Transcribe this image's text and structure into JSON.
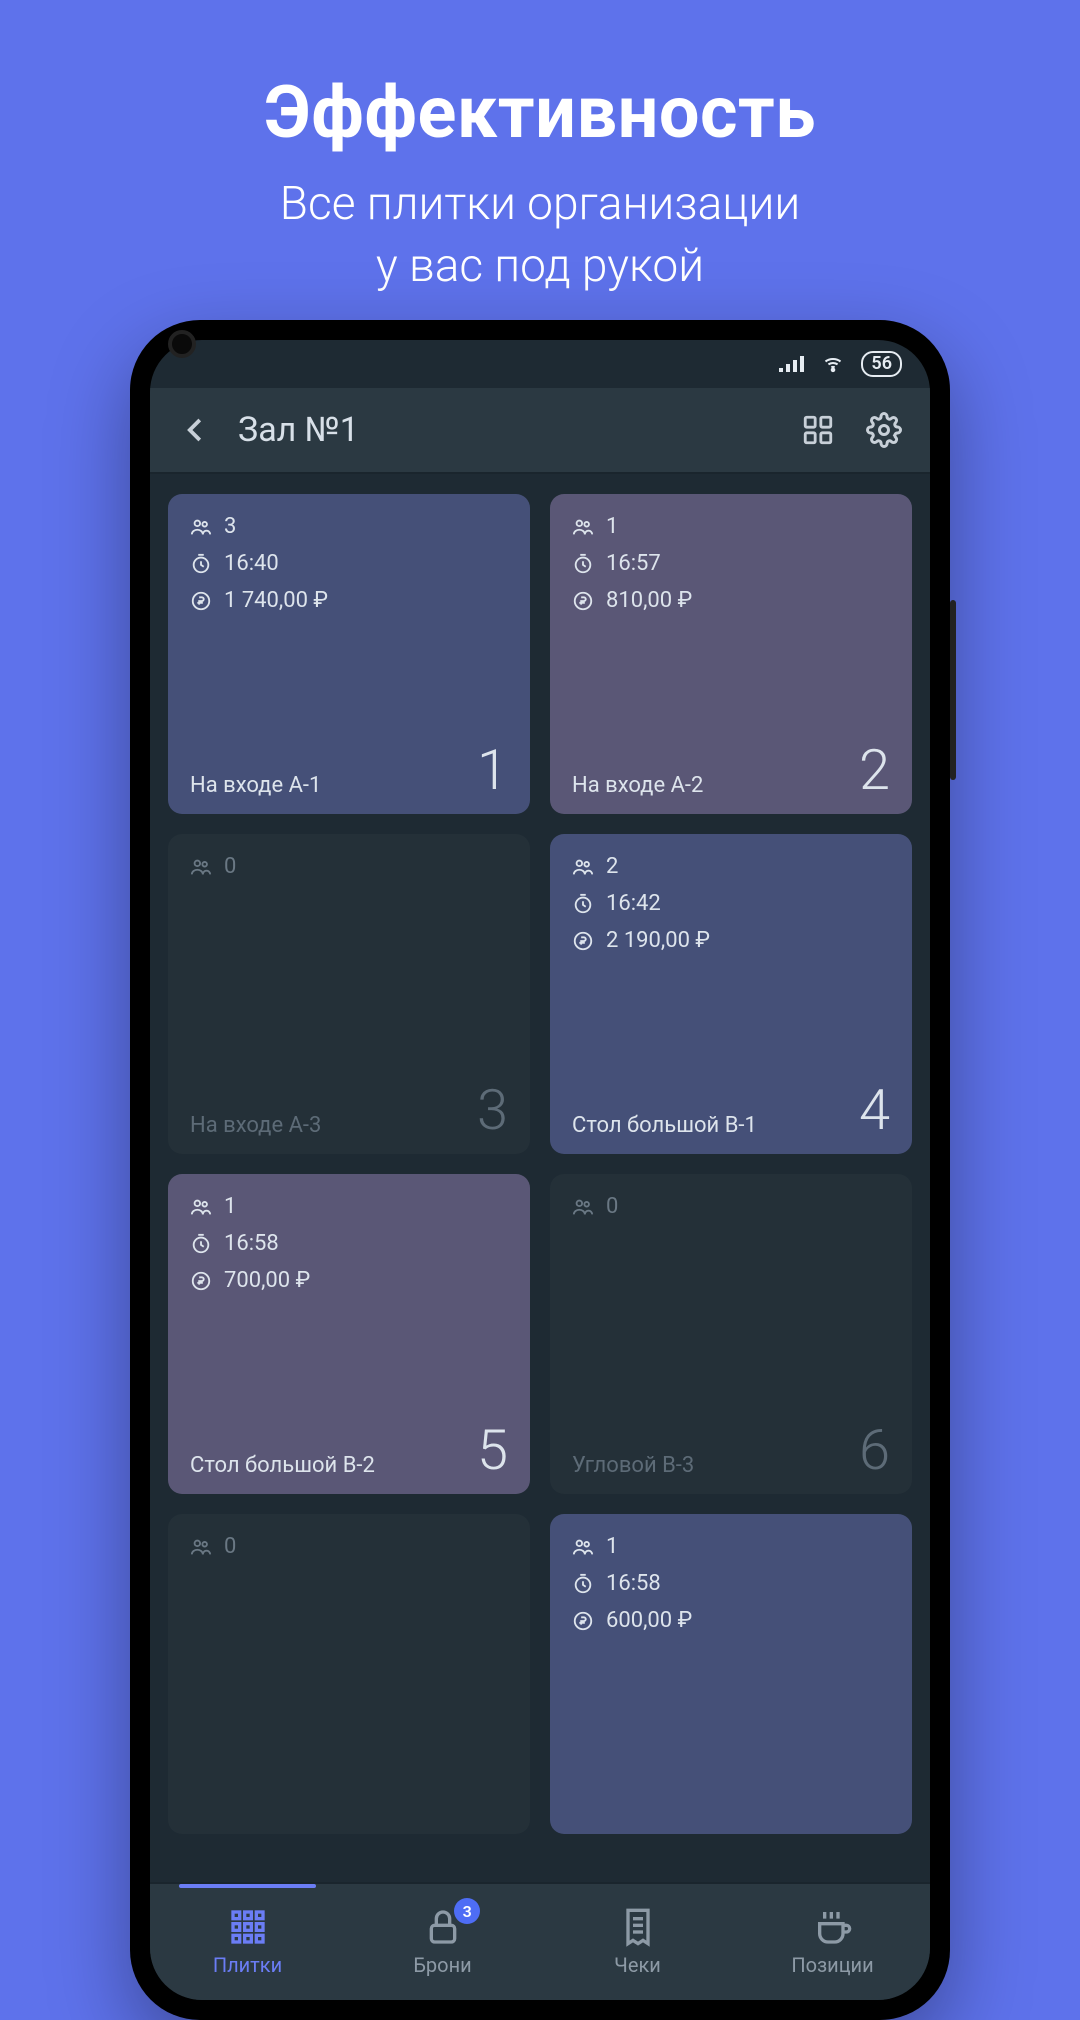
{
  "hero": {
    "title": "Эффективность",
    "subtitle_l1": "Все плитки организации",
    "subtitle_l2": "у вас под рукой"
  },
  "status": {
    "battery": "56"
  },
  "topbar": {
    "title": "Зал №1"
  },
  "tiles": [
    {
      "variant": "blue",
      "guests": "3",
      "time": "16:40",
      "amount": "1 740,00 ₽",
      "name": "На входе А-1",
      "num": "1"
    },
    {
      "variant": "purple",
      "guests": "1",
      "time": "16:57",
      "amount": "810,00 ₽",
      "name": "На входе А-2",
      "num": "2"
    },
    {
      "variant": "empty",
      "guests": "0",
      "time": "",
      "amount": "",
      "name": "На входе А-3",
      "num": "3"
    },
    {
      "variant": "blue",
      "guests": "2",
      "time": "16:42",
      "amount": "2 190,00 ₽",
      "name": "Стол большой В-1",
      "num": "4"
    },
    {
      "variant": "purple",
      "guests": "1",
      "time": "16:58",
      "amount": "700,00 ₽",
      "name": "Стол большой В-2",
      "num": "5"
    },
    {
      "variant": "empty",
      "guests": "0",
      "time": "",
      "amount": "",
      "name": "Угловой В-3",
      "num": "6"
    },
    {
      "variant": "empty",
      "guests": "0",
      "time": "",
      "amount": "",
      "name": "",
      "num": ""
    },
    {
      "variant": "blue",
      "guests": "1",
      "time": "16:58",
      "amount": "600,00 ₽",
      "name": "",
      "num": ""
    }
  ],
  "nav": {
    "items": [
      {
        "label": "Плитки",
        "badge": ""
      },
      {
        "label": "Брони",
        "badge": "3"
      },
      {
        "label": "Чеки",
        "badge": ""
      },
      {
        "label": "Позиции",
        "badge": ""
      }
    ]
  }
}
